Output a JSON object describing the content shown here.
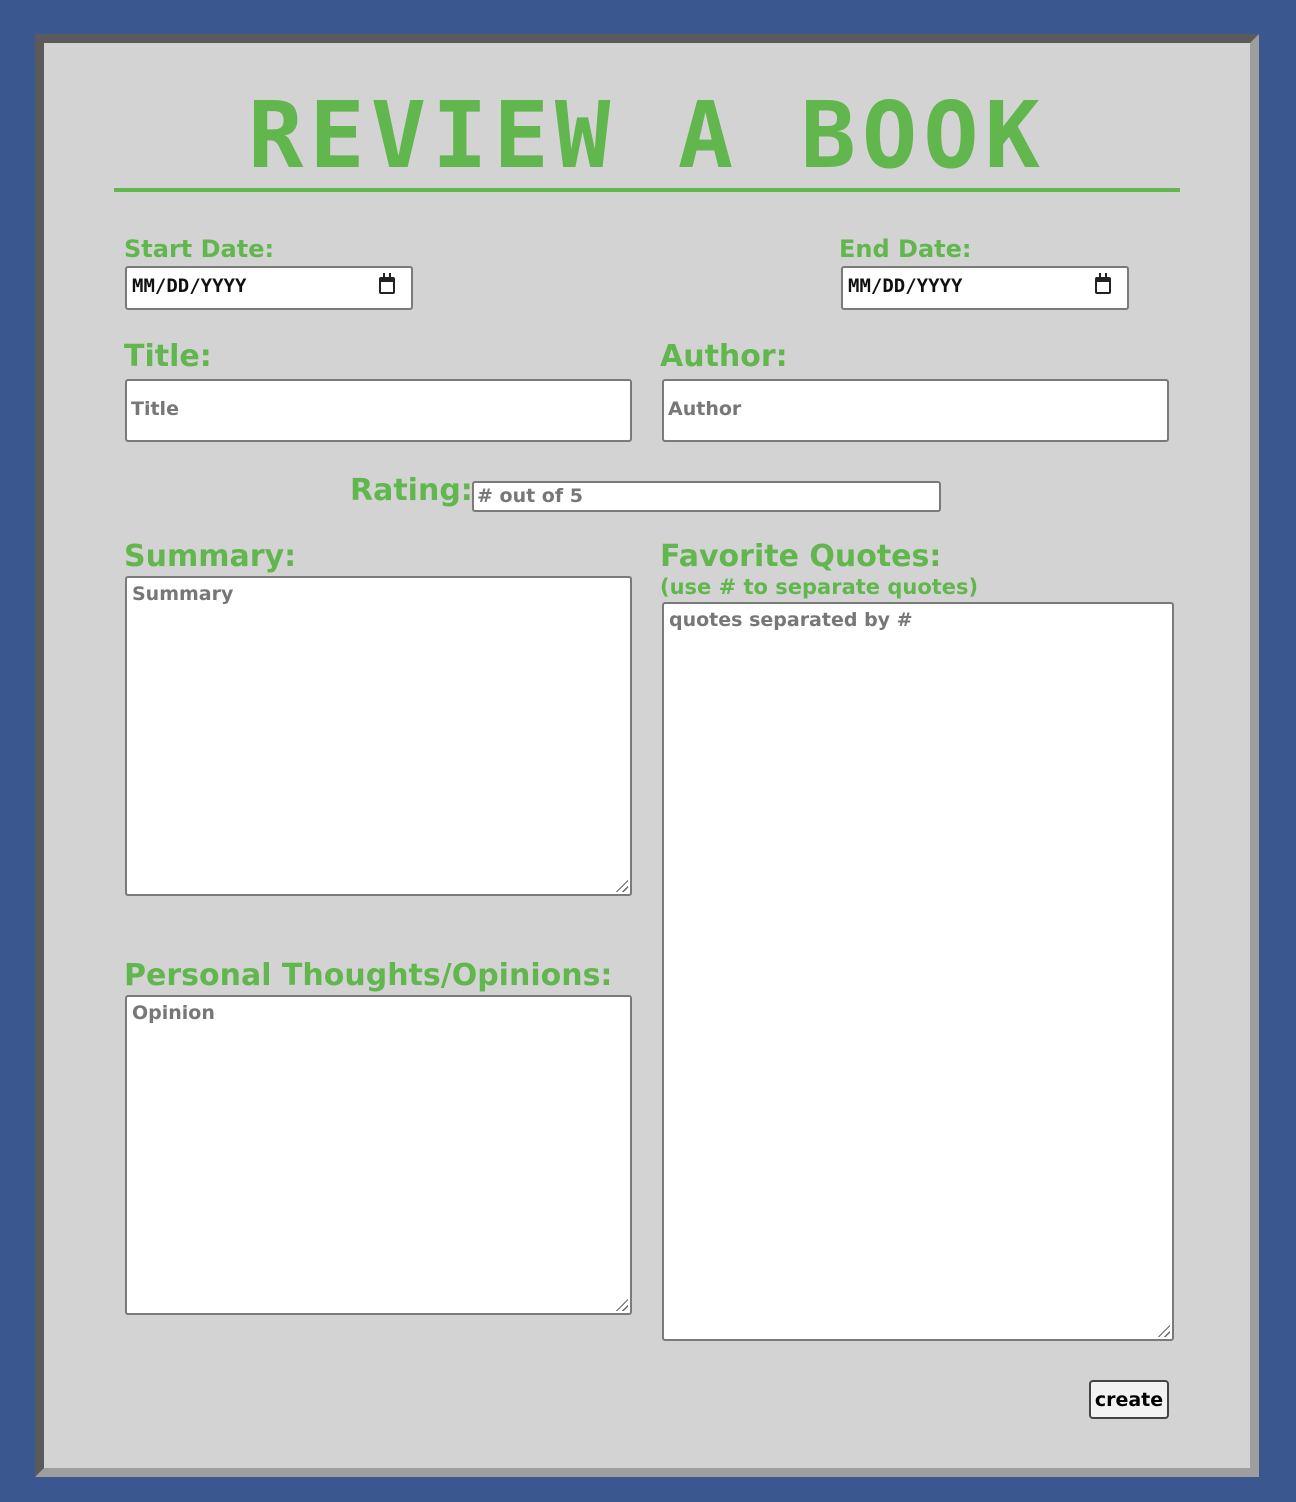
{
  "page": {
    "title": "REVIEW A BOOK"
  },
  "colors": {
    "background": "#3b578f",
    "card": "#d3d3d3",
    "accent": "#62b64e"
  },
  "start_date": {
    "label": "Start Date:",
    "value": "MM/DD/YYYY",
    "icon": "calendar-icon"
  },
  "end_date": {
    "label": "End Date:",
    "value": "MM/DD/YYYY",
    "icon": "calendar-icon"
  },
  "title_field": {
    "label": "Title:",
    "placeholder": "Title"
  },
  "author_field": {
    "label": "Author:",
    "placeholder": "Author"
  },
  "rating_field": {
    "label": "Rating:",
    "placeholder": "# out of 5"
  },
  "summary_field": {
    "label": "Summary:",
    "placeholder": "Summary"
  },
  "quotes_field": {
    "label": "Favorite Quotes:",
    "hint": "(use # to separate quotes)",
    "placeholder": "quotes separated by #"
  },
  "opinion_field": {
    "label": "Personal Thoughts/Opinions:",
    "placeholder": "Opinion"
  },
  "actions": {
    "create_label": "create"
  }
}
